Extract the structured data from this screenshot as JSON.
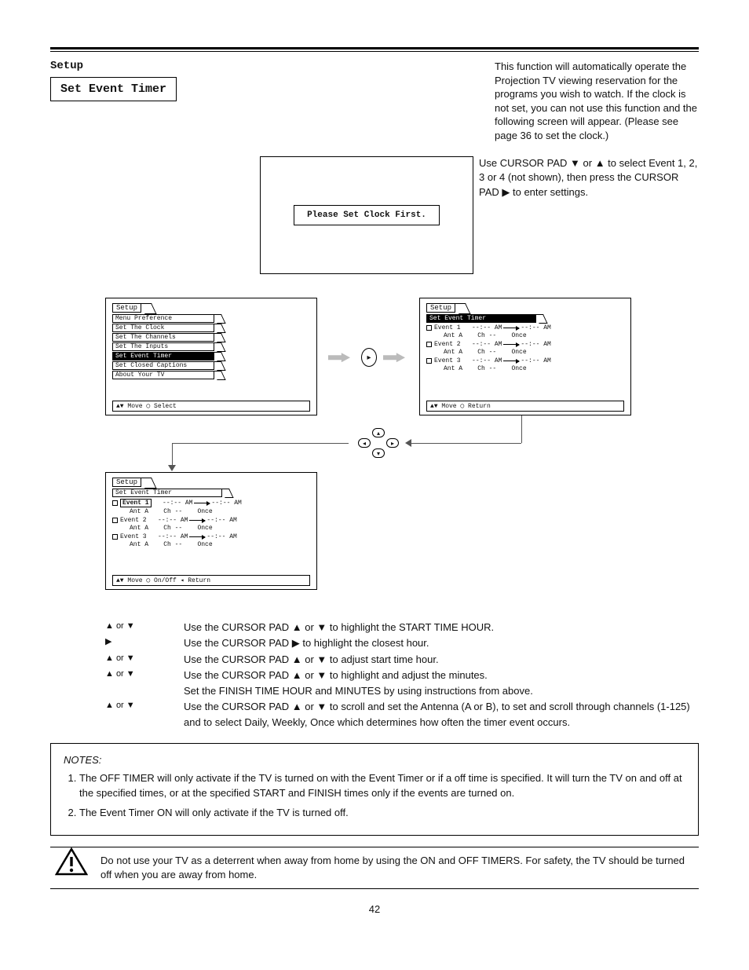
{
  "header": {
    "chapter": "Setup",
    "section_title": "Set Event Timer",
    "intro_right": "This function will automatically operate the Projection TV viewing reservation for the programs you wish to watch. If the clock is not set, you can not use this function and the following screen will appear. (Please see page 36 to set the clock.)"
  },
  "clock_screen": {
    "message": "Please Set Clock First."
  },
  "intro_right2": "Use CURSOR PAD ▼ or ▲ to select Event 1, 2, 3 or 4 (not shown), then press the CURSOR PAD ▶ to enter settings.",
  "screens": {
    "setup_menu": {
      "title": "Setup",
      "items": [
        "Menu Preference",
        "Set The Clock",
        "Set The Channels",
        "Set The Inputs",
        "Set Event Timer",
        "Set Closed Captions",
        "About Your TV"
      ],
      "selected_index": 4,
      "footer": "▲▼ Move   ◯ Select"
    },
    "event_list": {
      "title": "Setup",
      "subtitle": "Set Event Timer",
      "events": [
        {
          "label": "Event 1",
          "start": "--:-- AM",
          "end": "--:-- AM",
          "ant": "Ant A",
          "ch": "Ch --",
          "rep": "Once"
        },
        {
          "label": "Event 2",
          "start": "--:-- AM",
          "end": "--:-- AM",
          "ant": "Ant A",
          "ch": "Ch --",
          "rep": "Once"
        },
        {
          "label": "Event 3",
          "start": "--:-- AM",
          "end": "--:-- AM",
          "ant": "Ant A",
          "ch": "Ch --",
          "rep": "Once"
        }
      ],
      "footer": "▲▼ Move   ◯ Return"
    },
    "event_edit": {
      "title": "Setup",
      "subtitle": "Set Event Timer",
      "highlight_event_index": 0,
      "events": [
        {
          "label": "Event 1",
          "start": "--:-- AM",
          "end": "--:-- AM",
          "ant": "Ant A",
          "ch": "Ch --",
          "rep": "Once"
        },
        {
          "label": "Event 2",
          "start": "--:-- AM",
          "end": "--:-- AM",
          "ant": "Ant A",
          "ch": "Ch --",
          "rep": "Once"
        },
        {
          "label": "Event 3",
          "start": "--:-- AM",
          "end": "--:-- AM",
          "ant": "Ant A",
          "ch": "Ch --",
          "rep": "Once"
        }
      ],
      "footer": "▲▼ Move   ◯ On/Off   ◂ Return"
    }
  },
  "instructions": {
    "lines": [
      {
        "glyphs": "▲ or ▼",
        "text": "Use the CURSOR PAD ▲ or ▼ to highlight the START TIME HOUR."
      },
      {
        "glyphs": "▶",
        "text": "Use the CURSOR PAD ▶ to highlight the closest hour."
      },
      {
        "glyphs": "▲ or ▼",
        "text": "Use the CURSOR PAD ▲ or ▼ to adjust start time hour."
      },
      {
        "glyphs": "▲ or ▼",
        "text": "Use the CURSOR PAD ▲ or ▼ to highlight and adjust the minutes."
      },
      {
        "glyphs": "",
        "text": "Set the FINISH TIME HOUR and MINUTES by using instructions from above."
      },
      {
        "glyphs": "▲ or ▼",
        "text": "Use the CURSOR PAD ▲ or ▼ to scroll and set the Antenna (A or B), to set and scroll through channels (1-125) and to select Daily, Weekly, Once which determines how often the timer event occurs."
      }
    ]
  },
  "notes": {
    "heading": "NOTES:",
    "items": [
      "The OFF TIMER will only activate if the TV is turned on with the Event Timer or if a off time is specified. It will turn the TV on and off at the specified times, or at the specified START and FINISH times only if the events are turned on.",
      "The Event Timer ON will only activate if the TV is turned off."
    ]
  },
  "warning": {
    "text": "Do not use your TV as a deterrent when away from home by using the ON and OFF TIMERS. For safety, the TV should be turned off when you are away from home."
  },
  "page_number": "42"
}
